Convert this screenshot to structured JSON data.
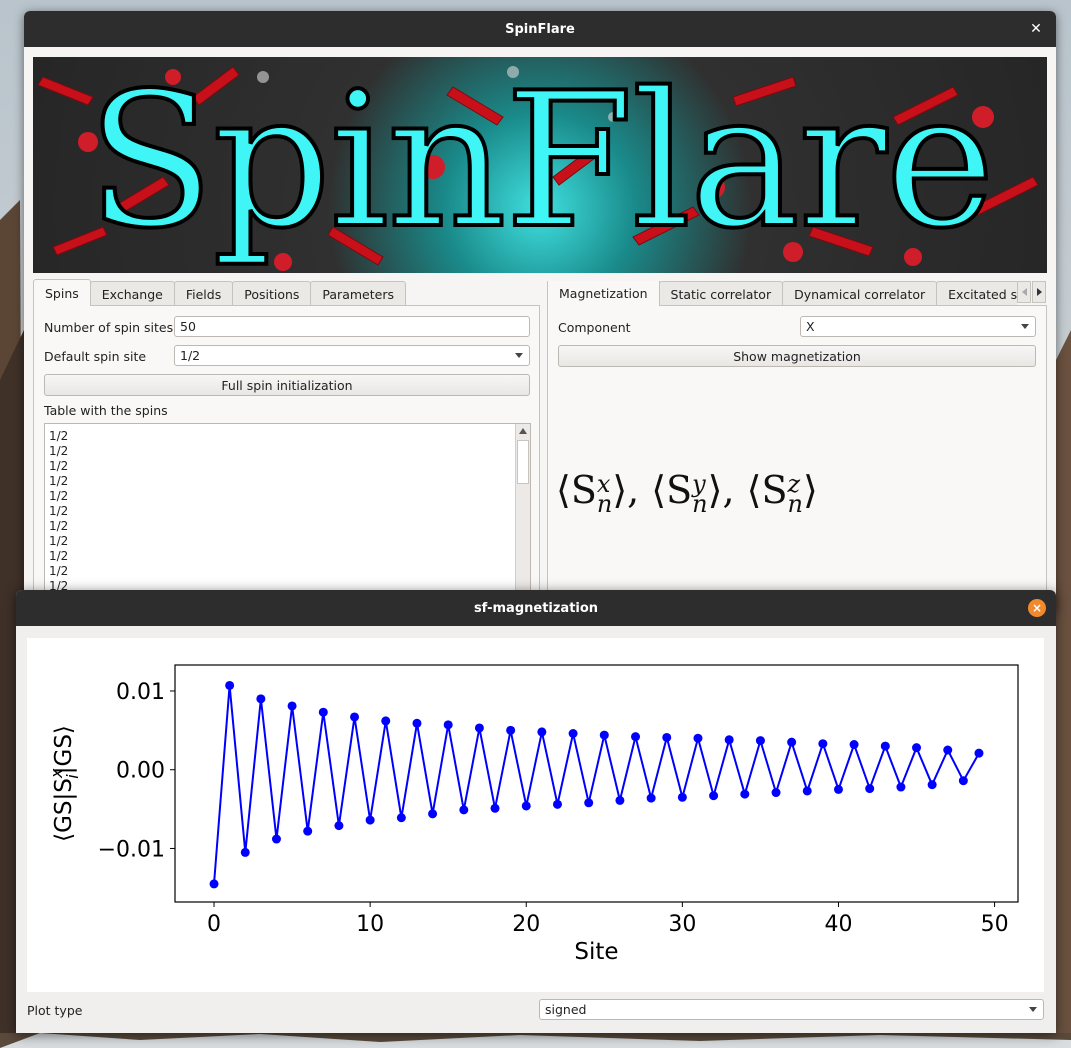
{
  "main_window": {
    "title": "SpinFlare",
    "close_glyph": "✕",
    "banner_text": "SpinFlare"
  },
  "left_tabs": [
    "Spins",
    "Exchange",
    "Fields",
    "Positions",
    "Parameters"
  ],
  "spins_panel": {
    "num_sites_label": "Number of spin sites",
    "num_sites_value": "50",
    "default_site_label": "Default spin site",
    "default_site_value": "1/2",
    "full_init_button": "Full spin initialization",
    "table_label": "Table with the spins",
    "table_items": [
      "1/2",
      "1/2",
      "1/2",
      "1/2",
      "1/2",
      "1/2",
      "1/2",
      "1/2",
      "1/2",
      "1/2",
      "1/2"
    ]
  },
  "right_tabs": [
    "Magnetization",
    "Static correlator",
    "Dynamical correlator",
    "Excitated sta"
  ],
  "magnetization_panel": {
    "component_label": "Component",
    "component_value": "X",
    "show_button": "Show magnetization",
    "formula_parts": [
      "⟨S",
      "x",
      "n",
      "⟩, ⟨S",
      "y",
      "n",
      "⟩, ⟨S",
      "z",
      "n",
      "⟩"
    ]
  },
  "mag_window": {
    "title": "sf-magnetization",
    "close_glyph": "×",
    "plot_type_label": "Plot type",
    "plot_type_value": "signed"
  },
  "chart_data": {
    "type": "line",
    "xlabel": "Site",
    "ylabel": "⟨GS|S",
    "ylabel_sup": "x",
    "ylabel_sub": "i",
    "ylabel_end": "|GS⟩",
    "xlim": [
      -2.5,
      51.5
    ],
    "ylim": [
      -0.0168,
      0.0133
    ],
    "xticks": [
      0,
      10,
      20,
      30,
      40,
      50
    ],
    "xtick_labels": [
      "0",
      "10",
      "20",
      "30",
      "40",
      "50"
    ],
    "yticks": [
      -0.01,
      0.0,
      0.01
    ],
    "ytick_labels": [
      "−0.01",
      "0.00",
      "0.01"
    ],
    "color": "#0000ff",
    "x": [
      0,
      1,
      2,
      3,
      4,
      5,
      6,
      7,
      8,
      9,
      10,
      11,
      12,
      13,
      14,
      15,
      16,
      17,
      18,
      19,
      20,
      21,
      22,
      23,
      24,
      25,
      26,
      27,
      28,
      29,
      30,
      31,
      32,
      33,
      34,
      35,
      36,
      37,
      38,
      39,
      40,
      41,
      42,
      43,
      44,
      45,
      46,
      47,
      48,
      49
    ],
    "y": [
      -0.0145,
      0.0107,
      -0.0105,
      0.009,
      -0.0088,
      0.0081,
      -0.0078,
      0.0073,
      -0.0071,
      0.0067,
      -0.0064,
      0.0062,
      -0.0061,
      0.0059,
      -0.0056,
      0.0057,
      -0.0051,
      0.0053,
      -0.0049,
      0.005,
      -0.0046,
      0.0048,
      -0.0044,
      0.0046,
      -0.0042,
      0.0044,
      -0.0039,
      0.0042,
      -0.0036,
      0.0041,
      -0.0035,
      0.004,
      -0.0033,
      0.0038,
      -0.0031,
      0.0037,
      -0.0029,
      0.0035,
      -0.0027,
      0.0033,
      -0.0025,
      0.0032,
      -0.0024,
      0.003,
      -0.0022,
      0.0028,
      -0.0019,
      0.0025,
      -0.0014,
      0.0021
    ]
  }
}
